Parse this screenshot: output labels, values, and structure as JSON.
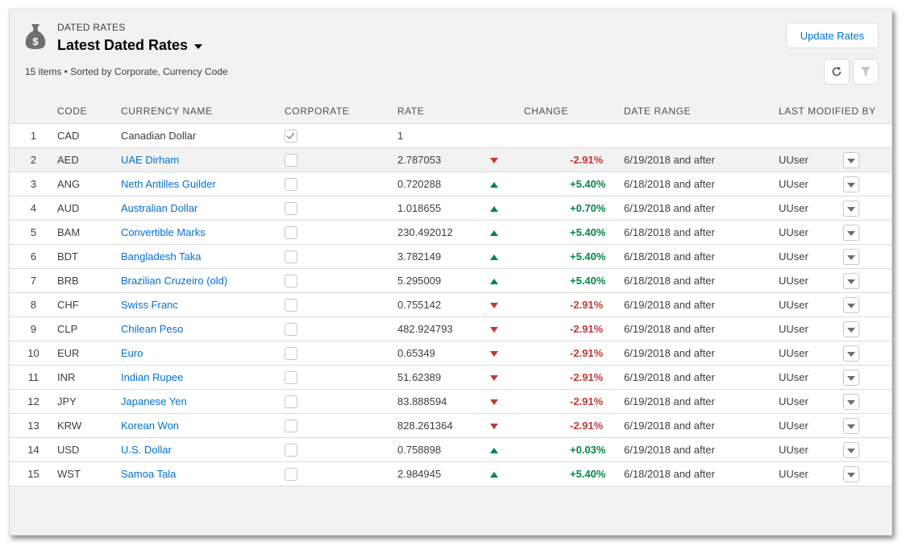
{
  "header": {
    "object_label": "DATED RATES",
    "title": "Latest Dated Rates",
    "meta": "15 items • Sorted by Corporate, Currency Code",
    "update_button": "Update Rates",
    "icons": {
      "object": "money-bag-icon",
      "refresh": "refresh-icon",
      "filter": "filter-icon"
    }
  },
  "colors": {
    "positive": "#04844b",
    "negative": "#c23934",
    "link": "#0070d2"
  },
  "table": {
    "columns": [
      "CODE",
      "CURRENCY NAME",
      "CORPORATE",
      "RATE",
      "CHANGE",
      "DATE RANGE",
      "LAST MODIFIED BY"
    ],
    "rows": [
      {
        "num": "1",
        "code": "CAD",
        "name": "Canadian Dollar",
        "corporate": true,
        "rate": "1",
        "direction": "",
        "change": "",
        "date_range": "",
        "modified_by": ""
      },
      {
        "num": "2",
        "code": "AED",
        "name": "UAE Dirham",
        "corporate": false,
        "rate": "2.787053",
        "direction": "down",
        "change": "-2.91%",
        "date_range": "6/19/2018 and after",
        "modified_by": "UUser"
      },
      {
        "num": "3",
        "code": "ANG",
        "name": "Neth Antilles Guilder",
        "corporate": false,
        "rate": "0.720288",
        "direction": "up",
        "change": "+5.40%",
        "date_range": "6/18/2018 and after",
        "modified_by": "UUser"
      },
      {
        "num": "4",
        "code": "AUD",
        "name": "Australian Dollar",
        "corporate": false,
        "rate": "1.018655",
        "direction": "up",
        "change": "+0.70%",
        "date_range": "6/19/2018 and after",
        "modified_by": "UUser"
      },
      {
        "num": "5",
        "code": "BAM",
        "name": "Convertible Marks",
        "corporate": false,
        "rate": "230.492012",
        "direction": "up",
        "change": "+5.40%",
        "date_range": "6/18/2018 and after",
        "modified_by": "UUser"
      },
      {
        "num": "6",
        "code": "BDT",
        "name": "Bangladesh Taka",
        "corporate": false,
        "rate": "3.782149",
        "direction": "up",
        "change": "+5.40%",
        "date_range": "6/18/2018 and after",
        "modified_by": "UUser"
      },
      {
        "num": "7",
        "code": "BRB",
        "name": "Brazilian Cruzeiro (old)",
        "corporate": false,
        "rate": "5.295009",
        "direction": "up",
        "change": "+5.40%",
        "date_range": "6/18/2018 and after",
        "modified_by": "UUser"
      },
      {
        "num": "8",
        "code": "CHF",
        "name": "Swiss Franc",
        "corporate": false,
        "rate": "0.755142",
        "direction": "down",
        "change": "-2.91%",
        "date_range": "6/19/2018 and after",
        "modified_by": "UUser"
      },
      {
        "num": "9",
        "code": "CLP",
        "name": "Chilean Peso",
        "corporate": false,
        "rate": "482.924793",
        "direction": "down",
        "change": "-2.91%",
        "date_range": "6/19/2018 and after",
        "modified_by": "UUser"
      },
      {
        "num": "10",
        "code": "EUR",
        "name": "Euro",
        "corporate": false,
        "rate": "0.65349",
        "direction": "down",
        "change": "-2.91%",
        "date_range": "6/19/2018 and after",
        "modified_by": "UUser"
      },
      {
        "num": "11",
        "code": "INR",
        "name": "Indian Rupee",
        "corporate": false,
        "rate": "51.62389",
        "direction": "down",
        "change": "-2.91%",
        "date_range": "6/19/2018 and after",
        "modified_by": "UUser"
      },
      {
        "num": "12",
        "code": "JPY",
        "name": "Japanese Yen",
        "corporate": false,
        "rate": "83.888594",
        "direction": "down",
        "change": "-2.91%",
        "date_range": "6/19/2018 and after",
        "modified_by": "UUser"
      },
      {
        "num": "13",
        "code": "KRW",
        "name": "Korean Won",
        "corporate": false,
        "rate": "828.261364",
        "direction": "down",
        "change": "-2.91%",
        "date_range": "6/19/2018 and after",
        "modified_by": "UUser"
      },
      {
        "num": "14",
        "code": "USD",
        "name": "U.S. Dollar",
        "corporate": false,
        "rate": "0.758898",
        "direction": "up",
        "change": "+0.03%",
        "date_range": "6/19/2018 and after",
        "modified_by": "UUser"
      },
      {
        "num": "15",
        "code": "WST",
        "name": "Samoa Tala",
        "corporate": false,
        "rate": "2.984945",
        "direction": "up",
        "change": "+5.40%",
        "date_range": "6/18/2018 and after",
        "modified_by": "UUser"
      }
    ]
  }
}
